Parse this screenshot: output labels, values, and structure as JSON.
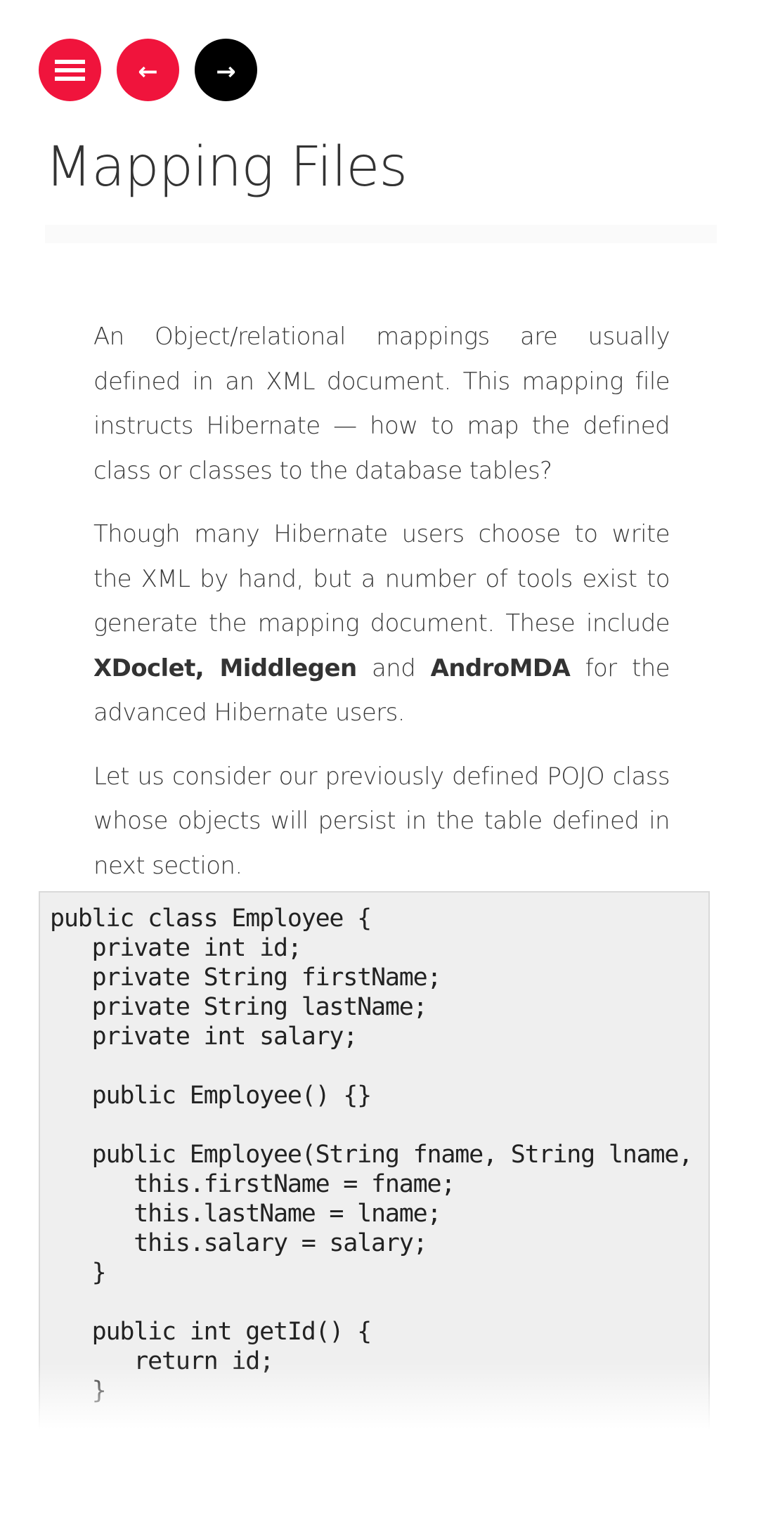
{
  "nav": {
    "menu_button": {
      "icon": "hamburger-menu-icon",
      "color": "#f0143c"
    },
    "back_button": {
      "icon": "arrow-left-icon",
      "glyph": "←",
      "color": "#f0143c"
    },
    "forward_button": {
      "icon": "arrow-right-icon",
      "glyph": "→",
      "color": "#000000"
    }
  },
  "page": {
    "title": "Mapping Files"
  },
  "content": {
    "paragraphs": [
      {
        "text": "An Object/relational mappings are usually defined in an XML document. This mapping file instructs Hibernate — how to map the defined class or classes to the database tables?"
      },
      {
        "prefix": "Though many Hibernate users choose to write the XML by hand, but a number of tools exist to generate the mapping document. These include ",
        "bold1": "XDoclet, Middlegen",
        "mid": " and ",
        "bold2": "AndroMDA",
        "suffix": " for the advanced Hibernate users."
      },
      {
        "text": "Let us consider our previously defined POJO class whose objects will persist in the table defined in next section."
      }
    ]
  },
  "code": {
    "language": "java",
    "text": "public class Employee {\n   private int id;\n   private String firstName;\n   private String lastName;\n   private int salary;\n\n   public Employee() {}\n\n   public Employee(String fname, String lname, int salary) {\n      this.firstName = fname;\n      this.lastName = lname;\n      this.salary = salary;\n   }\n\n   public int getId() {\n      return id;\n   }"
  }
}
